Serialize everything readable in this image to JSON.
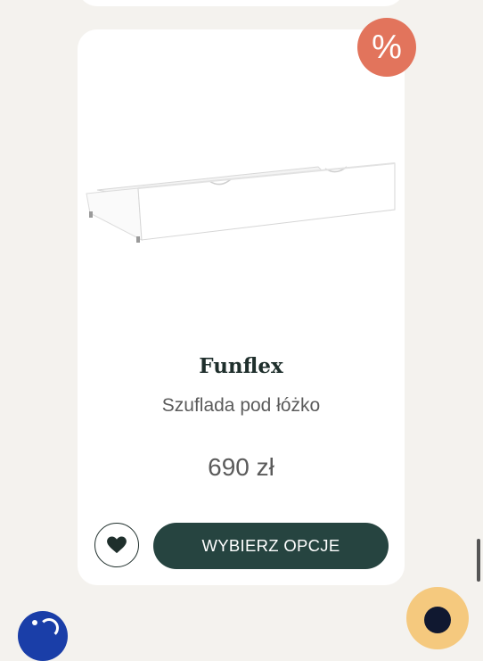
{
  "product": {
    "badge": "%",
    "brand": "Funflex",
    "name": "Szuflada pod łóżko",
    "price": "690 zł",
    "image_icon": "bed-drawer-image"
  },
  "actions": {
    "favorite_icon": "heart-icon",
    "choose_options_label": "WYBIERZ OPCJE"
  },
  "colors": {
    "background": "#f4f2ee",
    "card": "#ffffff",
    "badge": "#e2745c",
    "primary_button": "#264440",
    "chat_button": "#f5c97e",
    "info_bubble": "#1a3ea8"
  }
}
